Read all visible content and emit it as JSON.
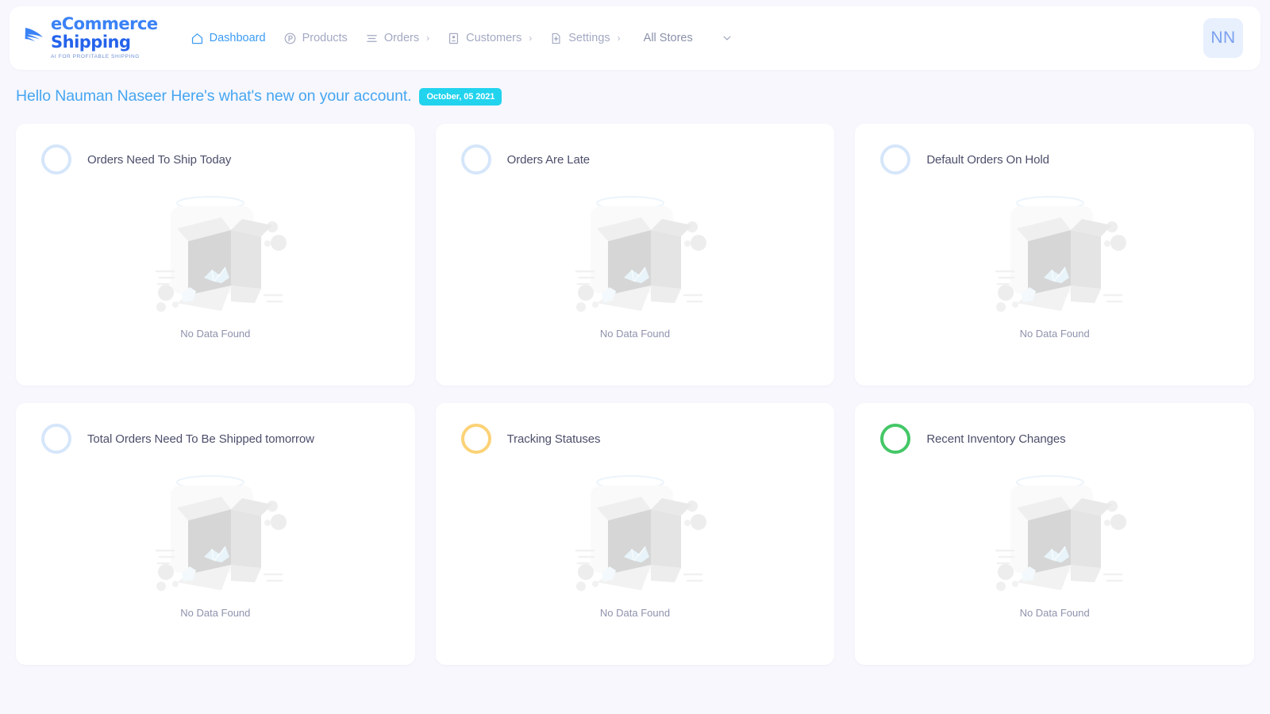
{
  "header": {
    "logo": {
      "line1": "eCommerce",
      "line2": "Shipping",
      "tagline": "AI FOR PROFITABLE SHIPPING",
      "mark_icon": "feather-quill-icon"
    },
    "nav": [
      {
        "label": "Dashboard",
        "icon": "home-icon",
        "active": true,
        "caret": ""
      },
      {
        "label": "Products",
        "icon": "circle-p-icon",
        "active": false,
        "caret": ""
      },
      {
        "label": "Orders",
        "icon": "list-lines-icon",
        "active": false,
        "caret": "›"
      },
      {
        "label": "Customers",
        "icon": "contact-card-icon",
        "active": false,
        "caret": "›"
      },
      {
        "label": "Settings",
        "icon": "file-gear-icon",
        "active": false,
        "caret": "›"
      }
    ],
    "store_selector": {
      "label": "All Stores",
      "chevron_icon": "chevron-down-icon"
    },
    "avatar": {
      "initials": "NN"
    }
  },
  "greeting": {
    "text": "Hello Nauman Naseer Here's what's new on your account.",
    "date_badge": "October, 05 2021"
  },
  "cards": [
    {
      "title": "Orders Need To Ship Today",
      "ring_color": "#d6e6fa",
      "empty_text": "No Data Found",
      "illustration": "empty-box-icon"
    },
    {
      "title": "Orders Are Late",
      "ring_color": "#d6e6fa",
      "empty_text": "No Data Found",
      "illustration": "empty-box-icon"
    },
    {
      "title": "Default Orders On Hold",
      "ring_color": "#d6e6fa",
      "empty_text": "No Data Found",
      "illustration": "empty-box-icon"
    },
    {
      "title": "Total Orders Need To Be Shipped tomorrow",
      "ring_color": "#d6e6fa",
      "empty_text": "No Data Found",
      "illustration": "empty-box-icon"
    },
    {
      "title": "Tracking Statuses",
      "ring_color": "#fbd277",
      "empty_text": "No Data Found",
      "illustration": "empty-box-icon"
    },
    {
      "title": "Recent Inventory Changes",
      "ring_color": "#44c767",
      "empty_text": "No Data Found",
      "illustration": "empty-box-icon"
    }
  ],
  "colors": {
    "page_background": "#f8f7fd",
    "card_background": "#ffffff",
    "accent_blue": "#3b9bf5",
    "brand_blue": "#2563eb",
    "badge_cyan": "#22d3ee",
    "nav_muted": "#a3a9c2",
    "title_text": "#4c4f6b"
  }
}
